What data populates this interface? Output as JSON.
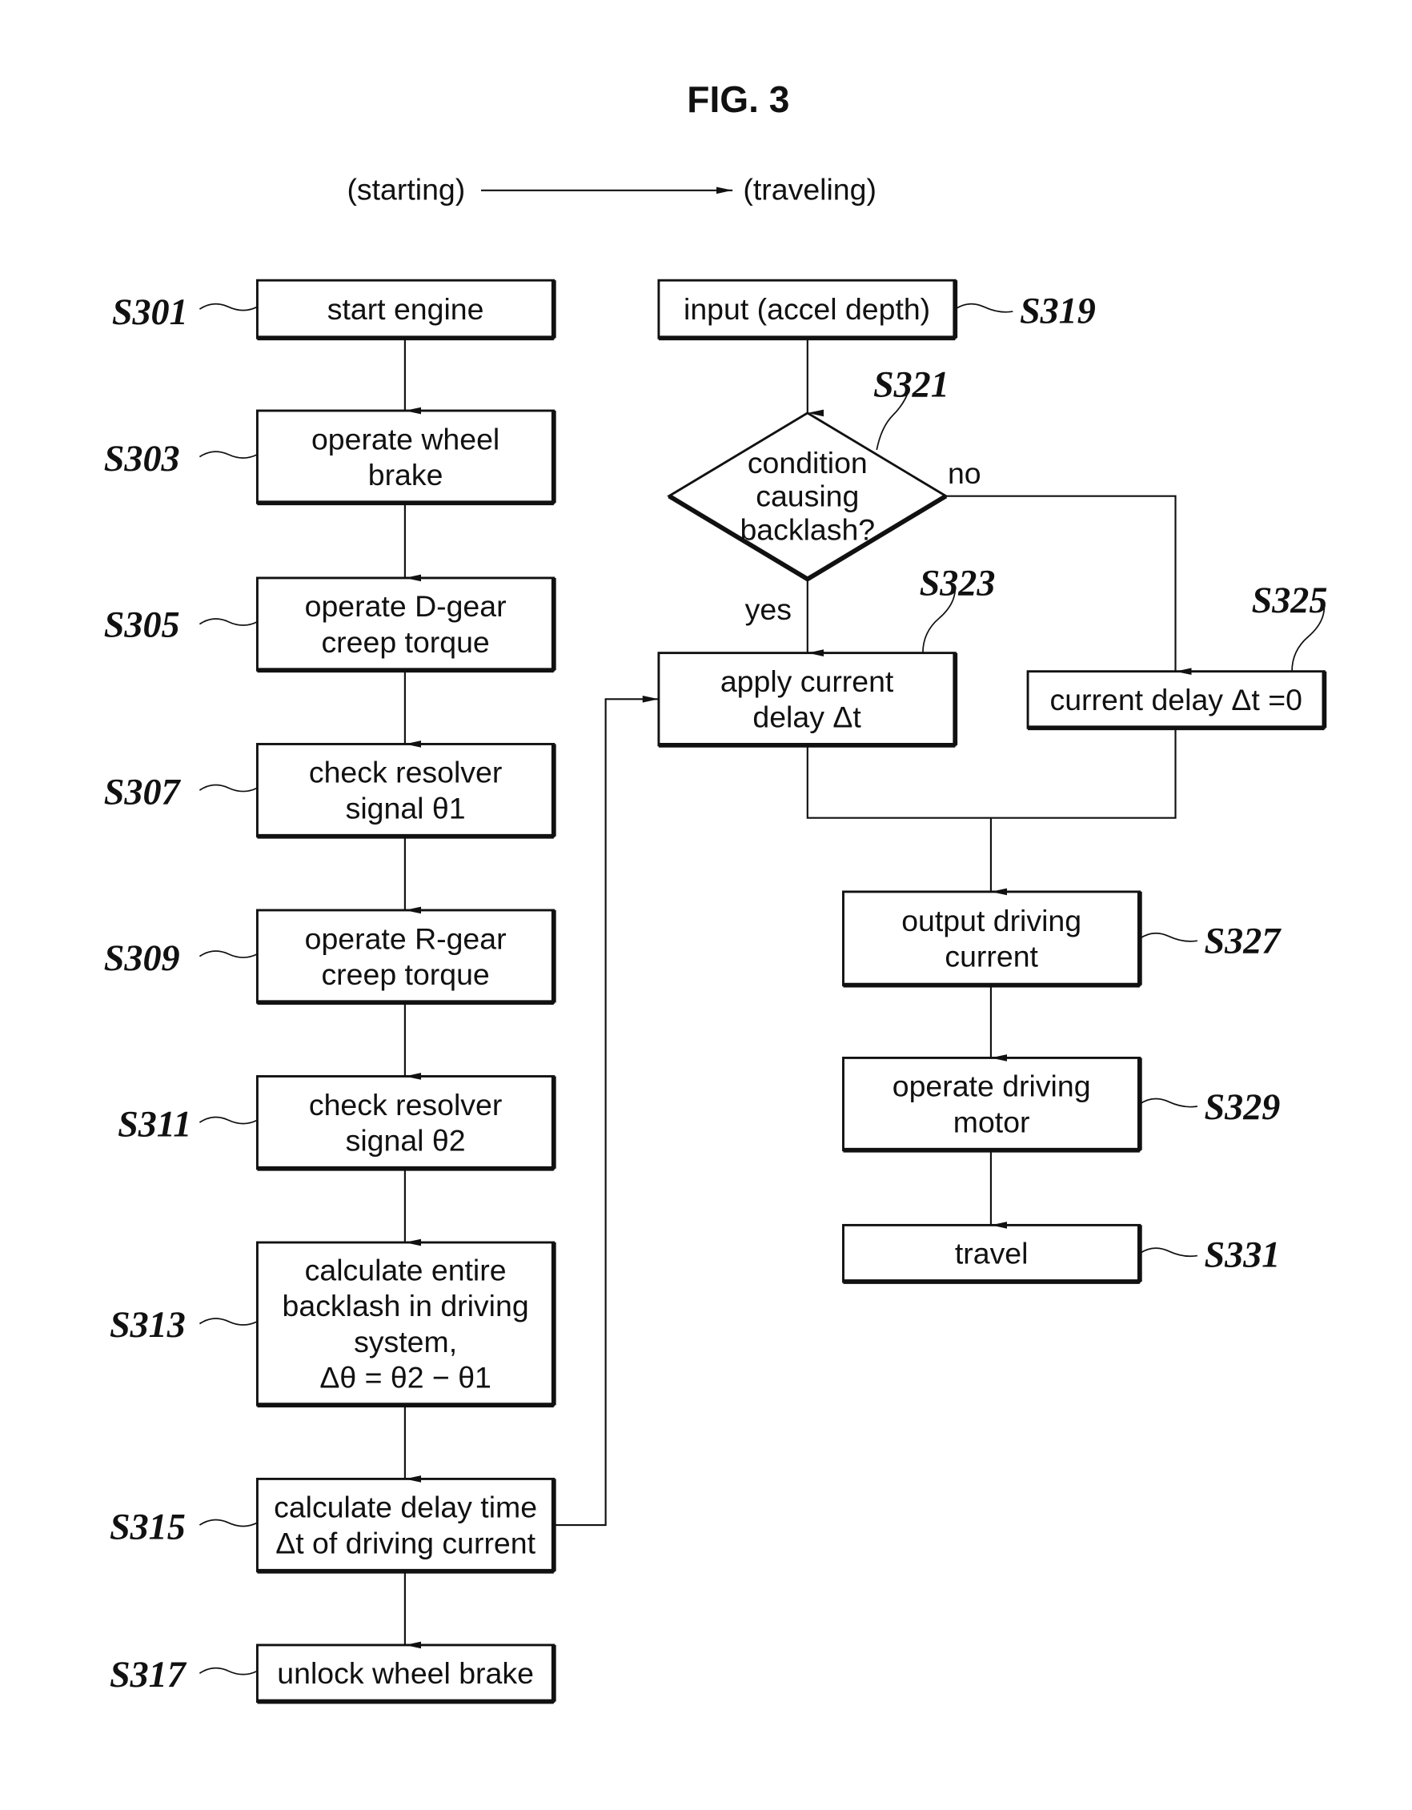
{
  "title": "FIG. 3",
  "phases": {
    "start": "(starting)",
    "travel": "(traveling)"
  },
  "steps": {
    "S301": {
      "id": "S301",
      "lines": [
        "start engine"
      ]
    },
    "S303": {
      "id": "S303",
      "lines": [
        "operate wheel",
        "brake"
      ]
    },
    "S305": {
      "id": "S305",
      "lines": [
        "operate D-gear",
        "creep torque"
      ]
    },
    "S307": {
      "id": "S307",
      "lines": [
        "check resolver",
        "signal θ1"
      ]
    },
    "S309": {
      "id": "S309",
      "lines": [
        "operate R-gear",
        "creep torque"
      ]
    },
    "S311": {
      "id": "S311",
      "lines": [
        "check resolver",
        "signal θ2"
      ]
    },
    "S313": {
      "id": "S313",
      "lines": [
        "calculate entire",
        "backlash in driving",
        "system,",
        "Δθ = θ2 − θ1"
      ]
    },
    "S315": {
      "id": "S315",
      "lines": [
        "calculate delay time",
        "Δt of driving current"
      ]
    },
    "S317": {
      "id": "S317",
      "lines": [
        "unlock wheel brake"
      ]
    },
    "S319": {
      "id": "S319",
      "lines": [
        "input (accel depth)"
      ]
    },
    "S321": {
      "id": "S321",
      "lines": [
        "condition",
        "causing",
        "backlash?"
      ]
    },
    "S323": {
      "id": "S323",
      "lines": [
        "apply current",
        "delay Δt"
      ]
    },
    "S325": {
      "id": "S325",
      "lines": [
        "current delay Δt =0"
      ]
    },
    "S327": {
      "id": "S327",
      "lines": [
        "output driving",
        "current"
      ]
    },
    "S329": {
      "id": "S329",
      "lines": [
        "operate driving",
        "motor"
      ]
    },
    "S331": {
      "id": "S331",
      "lines": [
        "travel"
      ]
    }
  },
  "branches": {
    "yes": "yes",
    "no": "no"
  }
}
